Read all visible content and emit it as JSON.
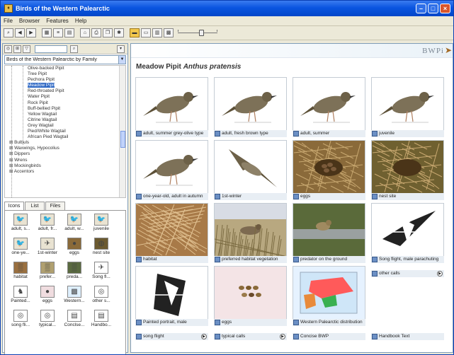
{
  "window": {
    "title": "Birds of the Western Palearctic",
    "icon": "app-icon"
  },
  "menu": [
    "File",
    "Browser",
    "Features",
    "Help"
  ],
  "left": {
    "taxonomy_combo": "Birds of the Western Palearctic by Family",
    "tree_items": [
      {
        "label": "Olive-backed Pipit",
        "kind": "leaf"
      },
      {
        "label": "Tree Pipit",
        "kind": "leaf"
      },
      {
        "label": "Pechora Pipit",
        "kind": "leaf"
      },
      {
        "label": "Meadow Pipit",
        "kind": "leaf",
        "selected": true
      },
      {
        "label": "Red-throated Pipit",
        "kind": "leaf"
      },
      {
        "label": "Water Pipit",
        "kind": "leaf"
      },
      {
        "label": "Rock Pipit",
        "kind": "leaf"
      },
      {
        "label": "Buff-bellied Pipit",
        "kind": "leaf"
      },
      {
        "label": "Yellow Wagtail",
        "kind": "leaf"
      },
      {
        "label": "Citrine Wagtail",
        "kind": "leaf"
      },
      {
        "label": "Grey Wagtail",
        "kind": "leaf"
      },
      {
        "label": "Pied/White Wagtail",
        "kind": "leaf"
      },
      {
        "label": "African Pied Wagtail",
        "kind": "leaf"
      },
      {
        "label": "Bulbuls",
        "kind": "group"
      },
      {
        "label": "Waxwings, Hypocolius",
        "kind": "group"
      },
      {
        "label": "Dippers",
        "kind": "group"
      },
      {
        "label": "Wrens",
        "kind": "group"
      },
      {
        "label": "Mockingbirds",
        "kind": "group"
      },
      {
        "label": "Accentors",
        "kind": "group"
      }
    ],
    "tabs": [
      "Icons",
      "List",
      "Files"
    ],
    "icons": [
      {
        "label": "adult, s...",
        "icon": "bird-photo-icon",
        "color": "#e9e3d2"
      },
      {
        "label": "adult, fr...",
        "icon": "bird-photo-icon",
        "color": "#e9e3d2"
      },
      {
        "label": "adult, w...",
        "icon": "bird-photo-icon",
        "color": "#e9e3d2"
      },
      {
        "label": "juvenile",
        "icon": "bird-photo-icon",
        "color": "#e9e3d2"
      },
      {
        "label": "one-ye...",
        "icon": "bird-photo-icon",
        "color": "#e9e3d2"
      },
      {
        "label": "1st-winter",
        "icon": "bird-flying-icon",
        "color": "#e9e3d2"
      },
      {
        "label": "eggs",
        "icon": "eggs-icon",
        "color": "#8a6a3a"
      },
      {
        "label": "nest site",
        "icon": "nest-icon",
        "color": "#6b5a30"
      },
      {
        "label": "habitat",
        "icon": "habitat-icon",
        "color": "#9a7040"
      },
      {
        "label": "prefer...",
        "icon": "habitat-icon",
        "color": "#b0a070"
      },
      {
        "label": "preda...",
        "icon": "habitat-icon",
        "color": "#5a6a40"
      },
      {
        "label": "Song fl...",
        "icon": "bird-flying-icon",
        "color": "#ffffff"
      },
      {
        "label": "Painted...",
        "icon": "painting-icon",
        "color": "#ffffff"
      },
      {
        "label": "eggs",
        "icon": "eggs-icon",
        "color": "#f0dde0"
      },
      {
        "label": "Western...",
        "icon": "map-icon",
        "color": "#dff0ff"
      },
      {
        "label": "other s...",
        "icon": "sound-icon",
        "color": "#ffffff"
      },
      {
        "label": "song fli...",
        "icon": "sound-icon",
        "color": "#ffffff"
      },
      {
        "label": "typical...",
        "icon": "sound-icon",
        "color": "#ffffff"
      },
      {
        "label": "Conclse...",
        "icon": "document-icon",
        "color": "#ffffff"
      },
      {
        "label": "Handbo...",
        "icon": "document-icon",
        "color": "#ffffff"
      }
    ]
  },
  "right": {
    "logo": "BWPi",
    "species_common": "Meadow Pipit",
    "species_latin": "Anthus pratensis",
    "cards": [
      {
        "caption": "adult, summer grey-olive type",
        "kind": "bird-standing",
        "bg": "#ffffff"
      },
      {
        "caption": "adult, fresh brown type",
        "kind": "bird-standing",
        "bg": "#ffffff"
      },
      {
        "caption": "adult, summer",
        "kind": "bird-standing",
        "bg": "#ffffff"
      },
      {
        "caption": "juvenile",
        "kind": "bird-standing",
        "bg": "#ffffff"
      },
      {
        "caption": "one-year-old, adult in autumn",
        "kind": "bird-standing",
        "bg": "#ffffff"
      },
      {
        "caption": "1st-winter",
        "kind": "bird-flying",
        "bg": "#ffffff"
      },
      {
        "caption": "eggs",
        "kind": "nest-eggs",
        "bg": "#8a6a3a"
      },
      {
        "caption": "nest site",
        "kind": "nest-grass",
        "bg": "#6f6030"
      },
      {
        "caption": "habitat",
        "kind": "grass",
        "bg": "#a87a48"
      },
      {
        "caption": "preferred habitat vegetation",
        "kind": "field",
        "bg": "#b8a880"
      },
      {
        "caption": "predator on the ground",
        "kind": "predator",
        "bg": "#5a6a3a"
      },
      {
        "caption": "Song flight, male parachuting",
        "kind": "song-flight",
        "bg": "#ffffff"
      },
      {
        "caption": "Painted portrait, male",
        "kind": "painting",
        "bg": "#ffffff"
      },
      {
        "caption": "eggs",
        "kind": "egg-set",
        "bg": "#f4e4e6"
      },
      {
        "caption": "Western Palearctic distribution",
        "kind": "map",
        "bg": "#e6f2ff"
      }
    ],
    "sound_captions": [
      "other calls",
      "song flight",
      "typical calls",
      "Concise BWP",
      "Handbook Text"
    ]
  }
}
